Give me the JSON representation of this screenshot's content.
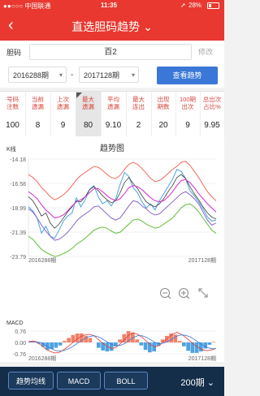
{
  "status_bar": {
    "carrier": "●●○○○ 中国联通",
    "time": "11:35",
    "battery": "28%",
    "battery_level": 0.28
  },
  "nav": {
    "back_icon": "back-chevron-icon",
    "title": "直选胆码趋势 ⌄"
  },
  "code_row": {
    "label": "胆码",
    "value": "百2",
    "edit_label": "修改"
  },
  "period_row": {
    "start": "2016288期",
    "separator": "-",
    "end": "2017128期",
    "view_button": "查看趋势"
  },
  "stats": {
    "columns": [
      {
        "header": "号码\n注数",
        "value": "100"
      },
      {
        "header": "当前\n遗漏",
        "value": "8"
      },
      {
        "header": "上次\n遗漏",
        "value": "9"
      },
      {
        "header": "最大\n遗漏",
        "value": "80"
      },
      {
        "header": "平均\n遗漏",
        "value": "9.10"
      },
      {
        "header": "最大\n连出",
        "value": "2"
      },
      {
        "header": "出现\n期数",
        "value": "20"
      },
      {
        "header": "100期\n出次",
        "value": "9"
      },
      {
        "header": "总出次\n占比%",
        "value": "9.95"
      }
    ]
  },
  "kline": {
    "label": "K线",
    "title": "趋势图",
    "y_ticks": [
      "-14.18",
      "-16.58",
      "-18.99",
      "-21.39",
      "-23.79"
    ],
    "x_start": "2016288期",
    "x_end": "2017128期"
  },
  "zoom_controls": {
    "zoom_out_icon": "zoom-out-icon",
    "zoom_in_icon": "zoom-in-icon",
    "fullscreen_icon": "expand-icon"
  },
  "macd": {
    "label": "MACD",
    "y_ticks": [
      "0.76",
      "0.00",
      "-0.76"
    ],
    "x_start": "2016288期",
    "x_end": "2017128期"
  },
  "bottom_bar": {
    "buttons": [
      "趋势均线",
      "MACD",
      "BOLL"
    ],
    "period": "200期 ⌄"
  },
  "colors": {
    "brand_red": "#e8382f",
    "button_blue": "#3a77d6",
    "bottom_bg": "#142d48"
  },
  "chart_data": {
    "type": "line",
    "title": "趋势图",
    "ylim": [
      -23.79,
      -14.18
    ],
    "series": [
      {
        "values": [
          -18.9,
          -19.3,
          -20.0,
          -21.5,
          -20.8,
          -21.8,
          -22.0,
          -21.2,
          -20.3,
          -19.8,
          -19.5,
          -18.0,
          -18.9,
          -18.2,
          -17.2,
          -16.8,
          -17.9,
          -18.6,
          -18.3,
          -18.8,
          -18.1,
          -16.7,
          -15.5,
          -15.9,
          -17.0,
          -17.5,
          -18.4,
          -19.0,
          -18.6,
          -19.2,
          -18.3,
          -17.6,
          -16.9,
          -16.2,
          -15.2,
          -15.4,
          -16.1,
          -17.3,
          -17.8,
          -18.4,
          -19.1,
          -19.9,
          -20.3,
          -20.2
        ]
      },
      {
        "values": [
          -17.9,
          -18.3,
          -19.0,
          -19.8,
          -19.5,
          -20.5,
          -21.0,
          -20.6,
          -20.0,
          -19.4,
          -18.9,
          -18.3,
          -18.4,
          -17.9,
          -17.2,
          -16.9,
          -17.3,
          -17.8,
          -18.2,
          -18.5,
          -18.3,
          -17.5,
          -16.5,
          -16.0,
          -16.6,
          -17.1,
          -17.8,
          -18.4,
          -18.7,
          -18.9,
          -18.6,
          -18.1,
          -17.4,
          -16.8,
          -16.0,
          -15.7,
          -16.1,
          -16.9,
          -17.6,
          -18.2,
          -18.9,
          -19.5,
          -19.9,
          -20.1
        ]
      },
      {
        "values": [
          -17.4,
          -17.7,
          -18.1,
          -18.7,
          -19.2,
          -19.6,
          -20.0,
          -19.9,
          -19.7,
          -19.3,
          -18.8,
          -18.4,
          -18.2,
          -17.9,
          -17.5,
          -17.1,
          -17.1,
          -17.4,
          -17.8,
          -18.1,
          -18.3,
          -18.1,
          -17.6,
          -17.0,
          -16.8,
          -16.9,
          -17.2,
          -17.6,
          -18.0,
          -18.3,
          -18.4,
          -18.3,
          -17.9,
          -17.4,
          -16.8,
          -16.3,
          -16.2,
          -16.5,
          -17.0,
          -17.6,
          -18.1,
          -18.6,
          -19.0,
          -19.4
        ]
      },
      {
        "values": [
          -19.1,
          -19.4,
          -20.0,
          -20.7,
          -21.3,
          -21.8,
          -22.2,
          -22.1,
          -21.8,
          -21.4,
          -20.9,
          -20.3,
          -19.9,
          -19.6,
          -19.3,
          -18.9,
          -18.8,
          -19.2,
          -19.6,
          -20.0,
          -20.2,
          -20.0,
          -19.4,
          -18.8,
          -18.3,
          -18.4,
          -18.8,
          -19.1,
          -19.5,
          -19.7,
          -19.6,
          -19.2,
          -18.8,
          -18.4,
          -18.0,
          -17.6,
          -17.4,
          -17.7,
          -18.1,
          -18.6,
          -19.4,
          -20.2,
          -20.7,
          -20.5
        ]
      },
      {
        "values": [
          -15.7,
          -16.0,
          -16.4,
          -17.0,
          -17.4,
          -17.9,
          -18.2,
          -18.0,
          -17.7,
          -17.3,
          -16.8,
          -16.2,
          -15.8,
          -15.5,
          -15.2,
          -14.9,
          -15.0,
          -15.3,
          -15.7,
          -16.0,
          -16.1,
          -15.8,
          -15.2,
          -14.7,
          -14.5,
          -14.7,
          -15.1,
          -15.6,
          -16.1,
          -16.4,
          -16.3,
          -16.0,
          -15.6,
          -15.2,
          -14.9,
          -14.5,
          -14.4,
          -14.8,
          -15.4,
          -16.0,
          -16.7,
          -17.4,
          -17.9,
          -18.3
        ]
      },
      {
        "values": [
          -21.8,
          -22.1,
          -22.6,
          -23.1,
          -23.4,
          -23.6,
          -23.8,
          -23.7,
          -23.5,
          -23.3,
          -23.0,
          -22.6,
          -22.3,
          -22.0,
          -21.6,
          -21.2,
          -21.0,
          -20.9,
          -21.0,
          -21.3,
          -21.5,
          -21.4,
          -21.0,
          -20.6,
          -20.2,
          -20.1,
          -20.3,
          -20.6,
          -20.8,
          -21.0,
          -20.9,
          -20.6,
          -20.3,
          -20.0,
          -19.5,
          -19.0,
          -18.7,
          -18.6,
          -18.9,
          -19.4,
          -20.0,
          -20.6,
          -21.2,
          -21.5
        ]
      }
    ],
    "macd": {
      "ylim": [
        -0.76,
        0.76
      ],
      "dif": [
        0.05,
        0.1,
        0.0,
        -0.2,
        -0.45,
        -0.6,
        -0.7,
        -0.68,
        -0.5,
        -0.3,
        -0.05,
        0.2,
        0.4,
        0.5,
        0.55,
        0.45,
        0.2,
        -0.05,
        -0.25,
        -0.4,
        -0.35,
        -0.1,
        0.2,
        0.5,
        0.65,
        0.55,
        0.35,
        0.1,
        -0.15,
        -0.3,
        -0.2,
        0.05,
        0.3,
        0.55,
        0.68,
        0.55,
        0.35,
        0.1,
        -0.15,
        -0.35,
        -0.5,
        -0.55,
        -0.5,
        -0.4
      ],
      "dea": [
        0.02,
        0.05,
        0.04,
        -0.05,
        -0.2,
        -0.38,
        -0.52,
        -0.58,
        -0.55,
        -0.45,
        -0.3,
        -0.1,
        0.1,
        0.28,
        0.4,
        0.45,
        0.38,
        0.22,
        0.05,
        -0.12,
        -0.22,
        -0.2,
        -0.08,
        0.12,
        0.32,
        0.45,
        0.45,
        0.35,
        0.18,
        0.0,
        -0.08,
        -0.05,
        0.08,
        0.25,
        0.42,
        0.5,
        0.48,
        0.38,
        0.2,
        0.0,
        -0.2,
        -0.35,
        -0.42,
        -0.42
      ],
      "hist": [
        0.06,
        0.1,
        -0.08,
        -0.3,
        -0.5,
        -0.44,
        -0.36,
        -0.2,
        0.1,
        0.3,
        0.5,
        0.6,
        0.6,
        0.44,
        0.3,
        0.0,
        -0.36,
        -0.54,
        -0.6,
        -0.56,
        -0.26,
        0.2,
        0.56,
        0.76,
        0.66,
        0.2,
        -0.2,
        -0.5,
        -0.66,
        -0.6,
        -0.24,
        0.2,
        0.44,
        0.6,
        0.52,
        0.1,
        -0.26,
        -0.56,
        -0.7,
        -0.7,
        -0.6,
        -0.4,
        -0.16,
        0.04
      ]
    }
  }
}
